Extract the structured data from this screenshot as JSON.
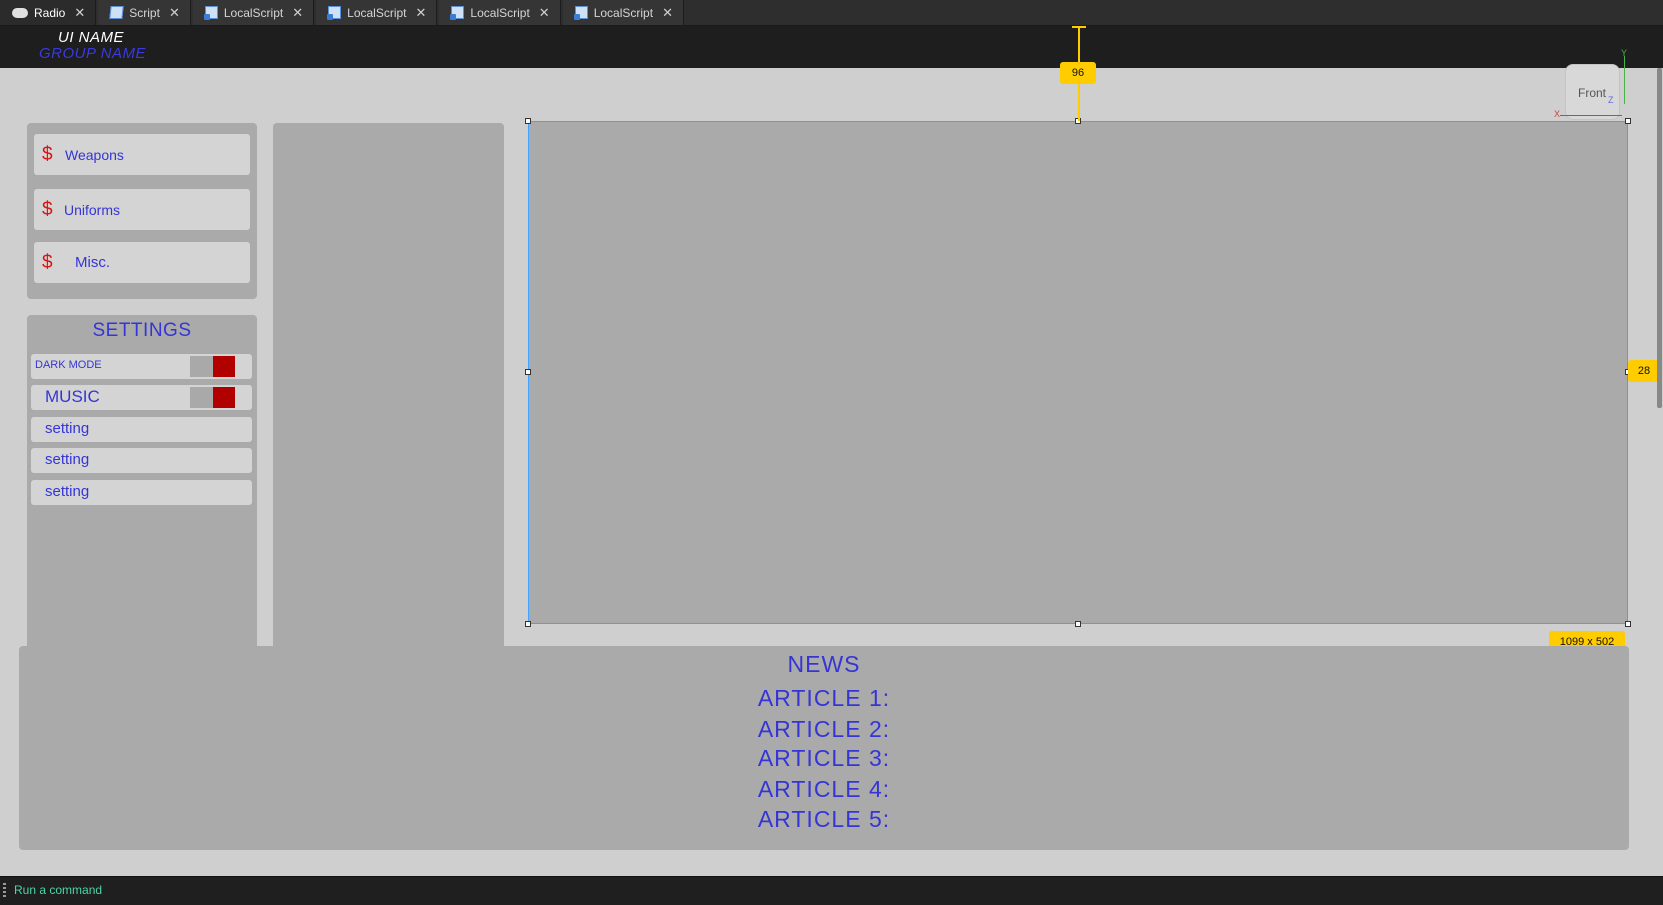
{
  "tabs": [
    {
      "label": "Radio",
      "icon": "cloud-icon",
      "active": true
    },
    {
      "label": "Script",
      "icon": "script-icon",
      "active": false
    },
    {
      "label": "LocalScript",
      "icon": "localscript-icon",
      "active": false
    },
    {
      "label": "LocalScript",
      "icon": "localscript-icon",
      "active": false
    },
    {
      "label": "LocalScript",
      "icon": "localscript-icon",
      "active": false
    },
    {
      "label": "LocalScript",
      "icon": "localscript-icon",
      "active": false
    }
  ],
  "tab_close_glyph": "✕",
  "header": {
    "ui_name": "UI NAME",
    "group_name": "GROUP NAME"
  },
  "shop": {
    "currency_symbol": "$",
    "items": [
      {
        "label": "Weapons"
      },
      {
        "label": "Uniforms"
      },
      {
        "label": "Misc."
      }
    ]
  },
  "settings": {
    "title": "SETTINGS",
    "toggles": [
      {
        "label": "DARK MODE",
        "on": true
      },
      {
        "label": "MUSIC",
        "on": true
      }
    ],
    "items": [
      {
        "label": "setting"
      },
      {
        "label": "setting"
      },
      {
        "label": "setting"
      }
    ]
  },
  "selection": {
    "top_offset": "96",
    "right_offset": "28",
    "size": "1099 x 502"
  },
  "view_cube": {
    "face": "Front",
    "axis_y": "Y",
    "axis_x": "X",
    "axis_z": "Z"
  },
  "news": {
    "title": "NEWS",
    "articles": [
      "ARTICLE 1:",
      "ARTICLE 2:",
      "ARTICLE 3:",
      "ARTICLE 4:",
      "ARTICLE 5:"
    ]
  },
  "command_bar": {
    "placeholder": "Run a command"
  },
  "colors": {
    "accent_text": "#3535d6",
    "currency": "#e01010",
    "toggle_on": "#b00000",
    "selection_outline": "#3fa3ff",
    "measure_badge": "#ffcc00",
    "command_text": "#4bd6a3"
  }
}
